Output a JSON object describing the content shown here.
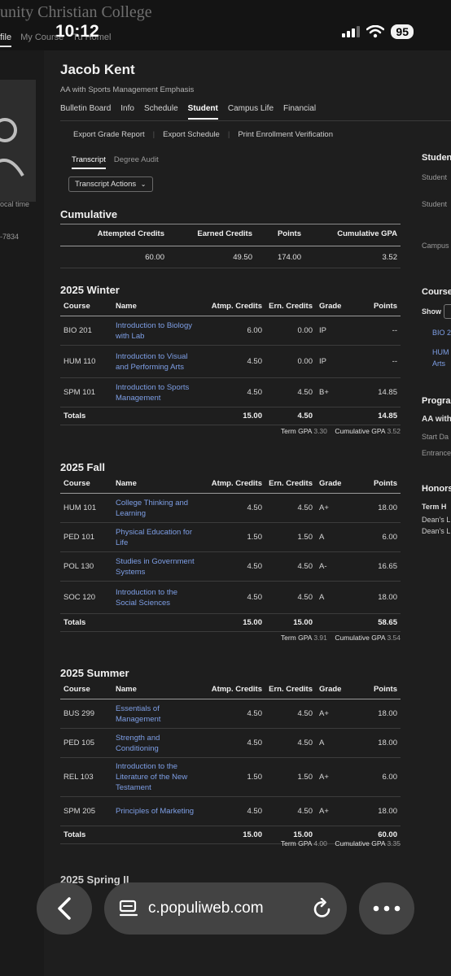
{
  "app": {
    "college_title": "unity Christian College",
    "top_tabs": [
      "file",
      "My Course",
      "Tu Homel"
    ]
  },
  "status_bar": {
    "time": "10:12",
    "battery": "95"
  },
  "sidebar": {
    "local_time": "ocal time",
    "phone": "-7834"
  },
  "student": {
    "name": "Jacob Kent",
    "program": "AA with Sports Management Emphasis"
  },
  "nav": [
    "Bulletin Board",
    "Info",
    "Schedule",
    "Student",
    "Campus Life",
    "Financial"
  ],
  "nav_active": "Student",
  "actions": [
    "Export Grade Report",
    "Export Schedule",
    "Print Enrollment Verification"
  ],
  "subtabs": [
    "Transcript",
    "Degree Audit"
  ],
  "dropdown": {
    "label": "Transcript Actions"
  },
  "cumulative": {
    "title": "Cumulative",
    "headers": [
      "Attempted Credits",
      "Earned Credits",
      "Points",
      "Cumulative GPA"
    ],
    "values": [
      "60.00",
      "49.50",
      "174.00",
      "3.52"
    ]
  },
  "term_headers": [
    "Course",
    "Name",
    "Atmp. Credits",
    "Ern. Credits",
    "Grade",
    "Points"
  ],
  "terms": [
    {
      "title": "2025 Winter",
      "rows": [
        [
          "BIO 201",
          "Introduction to Biology with Lab",
          "6.00",
          "0.00",
          "IP",
          "--"
        ],
        [
          "HUM 110",
          "Introduction to Visual and Performing Arts",
          "4.50",
          "0.00",
          "IP",
          "--"
        ],
        [
          "SPM 101",
          "Introduction to Sports Management",
          "4.50",
          "4.50",
          "B+",
          "14.85"
        ]
      ],
      "totals": [
        "Totals",
        "15.00",
        "4.50",
        "14.85"
      ],
      "term_gpa_label": "Term GPA",
      "term_gpa": "3.30",
      "cum_gpa_label": "Cumulative GPA",
      "cum_gpa": "3.52"
    },
    {
      "title": "2025 Fall",
      "rows": [
        [
          "HUM 101",
          "College Thinking and Learning",
          "4.50",
          "4.50",
          "A+",
          "18.00"
        ],
        [
          "PED 101",
          "Physical Education for Life",
          "1.50",
          "1.50",
          "A",
          "6.00"
        ],
        [
          "POL 130",
          "Studies in Government Systems",
          "4.50",
          "4.50",
          "A-",
          "16.65"
        ],
        [
          "SOC 120",
          "Introduction to the Social Sciences",
          "4.50",
          "4.50",
          "A",
          "18.00"
        ]
      ],
      "totals": [
        "Totals",
        "15.00",
        "15.00",
        "58.65"
      ],
      "term_gpa_label": "Term GPA",
      "term_gpa": "3.91",
      "cum_gpa_label": "Cumulative GPA",
      "cum_gpa": "3.54"
    },
    {
      "title": "2025 Summer",
      "rows": [
        [
          "BUS 299",
          "Essentials of Management",
          "4.50",
          "4.50",
          "A+",
          "18.00"
        ],
        [
          "PED 105",
          "Strength and Conditioning",
          "4.50",
          "4.50",
          "A",
          "18.00"
        ],
        [
          "REL 103",
          "Introduction to the Literature of the New Testament",
          "1.50",
          "1.50",
          "A+",
          "6.00"
        ],
        [
          "SPM 205",
          "Principles of Marketing",
          "4.50",
          "4.50",
          "A+",
          "18.00"
        ]
      ],
      "totals": [
        "Totals",
        "15.00",
        "15.00",
        "60.00"
      ],
      "term_gpa_label": "Term GPA",
      "term_gpa": "4.00",
      "cum_gpa_label": "Cumulative GPA",
      "cum_gpa": "3.35"
    }
  ],
  "next_term_title": "2025 Spring II",
  "right_panel": {
    "student_heading": "Studen",
    "student_1": "Student",
    "student_2": "Student",
    "campus": "Campus",
    "courses_heading": "Course",
    "show_label": "Show",
    "course_links": [
      "BIO 2",
      "HUM",
      "Arts"
    ],
    "program_heading": "Progra",
    "program_name": "AA with",
    "start_date": "Start Da",
    "entrance": "Entrance",
    "honors_heading": "Honors",
    "term_honors": "Term H",
    "deans_1": "Dean's L",
    "deans_2": "Dean's L"
  },
  "browser": {
    "url": "c.populiweb.com"
  }
}
